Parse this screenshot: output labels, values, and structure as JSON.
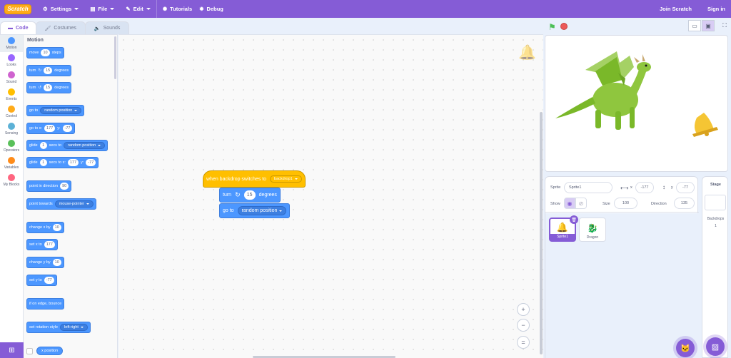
{
  "menubar": {
    "logo": "Scratch",
    "settings": "Settings",
    "file": "File",
    "edit": "Edit",
    "tutorials": "Tutorials",
    "debug": "Debug",
    "join": "Join Scratch",
    "signin": "Sign in"
  },
  "tabs": {
    "code": "Code",
    "costumes": "Costumes",
    "sounds": "Sounds"
  },
  "categories": [
    {
      "label": "Motion",
      "color": "#4c97ff"
    },
    {
      "label": "Looks",
      "color": "#9966ff"
    },
    {
      "label": "Sound",
      "color": "#cf63cf"
    },
    {
      "label": "Events",
      "color": "#ffbf00"
    },
    {
      "label": "Control",
      "color": "#ffab19"
    },
    {
      "label": "Sensing",
      "color": "#5cb1d6"
    },
    {
      "label": "Operators",
      "color": "#59c059"
    },
    {
      "label": "Variables",
      "color": "#ff8c1a"
    },
    {
      "label": "My Blocks",
      "color": "#ff6680"
    }
  ],
  "palette": {
    "title": "Motion",
    "move": {
      "a": "move",
      "n": "10",
      "b": "steps"
    },
    "turn_right": {
      "a": "turn",
      "n": "15",
      "b": "degrees"
    },
    "turn_left": {
      "a": "turn",
      "n": "15",
      "b": "degrees"
    },
    "goto": {
      "a": "go to",
      "d": "random position"
    },
    "gotoxy": {
      "a": "go to x:",
      "x": "177",
      "b": "y:",
      "y": "-77"
    },
    "glide_to": {
      "a": "glide",
      "n": "1",
      "b": "secs to",
      "d": "random position"
    },
    "glide_xy": {
      "a": "glide",
      "n": "1",
      "b": "secs to x:",
      "x": "177",
      "c": "y:",
      "y": "-77"
    },
    "point_dir": {
      "a": "point in direction",
      "n": "90"
    },
    "point_towards": {
      "a": "point towards",
      "d": "mouse-pointer"
    },
    "change_x": {
      "a": "change x by",
      "n": "10"
    },
    "set_x": {
      "a": "set x to",
      "n": "177"
    },
    "change_y": {
      "a": "change y by",
      "n": "10"
    },
    "set_y": {
      "a": "set y to",
      "n": "-77"
    },
    "bounce": "if on edge, bounce",
    "rotation": {
      "a": "set rotation style",
      "d": "left-right"
    },
    "xpos": "x position"
  },
  "script": {
    "hat": {
      "a": "when backdrop switches to",
      "d": "backdrop1"
    },
    "turn": {
      "a": "turn",
      "n": "15",
      "b": "degrees"
    },
    "goto": {
      "a": "go to",
      "d": "random position"
    }
  },
  "zoom": {
    "in": "+",
    "out": "−",
    "reset": "="
  },
  "sprite_info": {
    "sprite_label": "Sprite",
    "sprite_name": "Sprite1",
    "x_label": "x",
    "x": "-177",
    "y_label": "y",
    "y": "-77",
    "show_label": "Show",
    "size_label": "Size",
    "size": "100",
    "direction_label": "Direction",
    "direction": "135"
  },
  "sprites": [
    {
      "name": "Sprite1",
      "selected": true
    },
    {
      "name": "Dragon",
      "selected": false
    }
  ],
  "stage_pane": {
    "title": "Stage",
    "backdrops_label": "Backdrops",
    "backdrops_count": "1"
  }
}
